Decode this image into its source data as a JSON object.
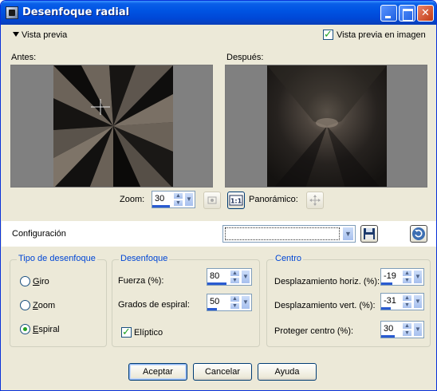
{
  "window": {
    "title": "Desenfoque radial"
  },
  "preview": {
    "toggle_label": "Vista previa",
    "in_image_label": "Vista previa en imagen",
    "in_image_checked": true,
    "before_label": "Antes:",
    "after_label": "Después:",
    "zoom_label": "Zoom:",
    "zoom_value": "30",
    "panoramic_label": "Panorámico:"
  },
  "config": {
    "label": "Configuración",
    "preset_value": ""
  },
  "blur_type": {
    "title": "Tipo de desenfoque",
    "options": [
      {
        "label": "Giro",
        "hotkey": "G",
        "rest": "iro",
        "checked": false
      },
      {
        "label": "Zoom",
        "hotkey": "Z",
        "rest": "oom",
        "checked": false
      },
      {
        "label": "Espiral",
        "hotkey": "E",
        "rest": "spiral",
        "checked": true
      }
    ]
  },
  "blur": {
    "title": "Desenfoque",
    "strength": {
      "label": "Fuerza (%):",
      "value": "80",
      "level": 0.8
    },
    "spiral_degrees": {
      "label": "Grados de espiral:",
      "value": "50",
      "level": 0.28
    },
    "elliptic": {
      "label": "Elíptico",
      "checked": true
    }
  },
  "center": {
    "title": "Centro",
    "h_offset": {
      "label": "Desplazamiento horiz. (%):",
      "value": "-19",
      "level": 0.4
    },
    "v_offset": {
      "label": "Desplazamiento vert. (%):",
      "value": "-31",
      "level": 0.35
    },
    "protect": {
      "label": "Proteger centro (%):",
      "value": "30",
      "level": 0.3
    }
  },
  "buttons": {
    "ok": "Aceptar",
    "cancel": "Cancelar",
    "help": "Ayuda"
  }
}
